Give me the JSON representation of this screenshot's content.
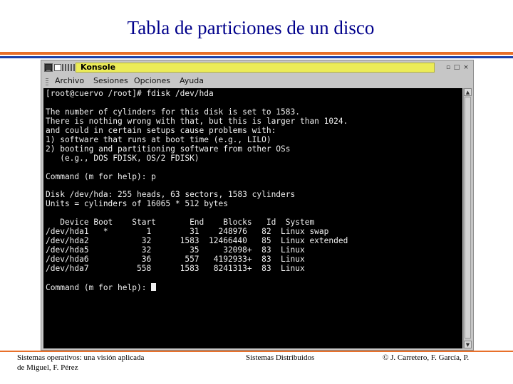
{
  "slide": {
    "title": "Tabla de particiones de un disco"
  },
  "window": {
    "title": "Konsole",
    "menu": [
      "Archivo",
      "Sesiones",
      "Opciones",
      "Ayuda"
    ],
    "buttons": [
      "▫",
      "□",
      "×"
    ]
  },
  "terminal": {
    "lines": [
      "[root@cuervo /root]# fdisk /dev/hda",
      "",
      "The number of cylinders for this disk is set to 1583.",
      "There is nothing wrong with that, but this is larger than 1024.",
      "and could in certain setups cause problems with:",
      "1) software that runs at boot time (e.g., LILO)",
      "2) booting and partitioning software from other OSs",
      "   (e.g., DOS FDISK, OS/2 FDISK)",
      "",
      "Command (m for help): p",
      "",
      "Disk /dev/hda: 255 heads, 63 sectors, 1583 cylinders",
      "Units = cylinders of 16065 * 512 bytes",
      "",
      "   Device Boot    Start       End    Blocks   Id  System",
      "/dev/hda1   *        1        31    248976   82  Linux swap",
      "/dev/hda2           32      1583  12466440   85  Linux extended",
      "/dev/hda5           32        35     32098+  83  Linux",
      "/dev/hda6           36       557   4192933+  83  Linux",
      "/dev/hda7          558      1583   8241313+  83  Linux",
      "",
      "Command (m for help): "
    ]
  },
  "footer": {
    "left_line1": "Sistemas operativos: una visión aplicada",
    "left_line2": "de Miguel, F. Pérez",
    "center": "Sistemas Distribuidos",
    "right": "© J. Carretero, F. García, P."
  }
}
